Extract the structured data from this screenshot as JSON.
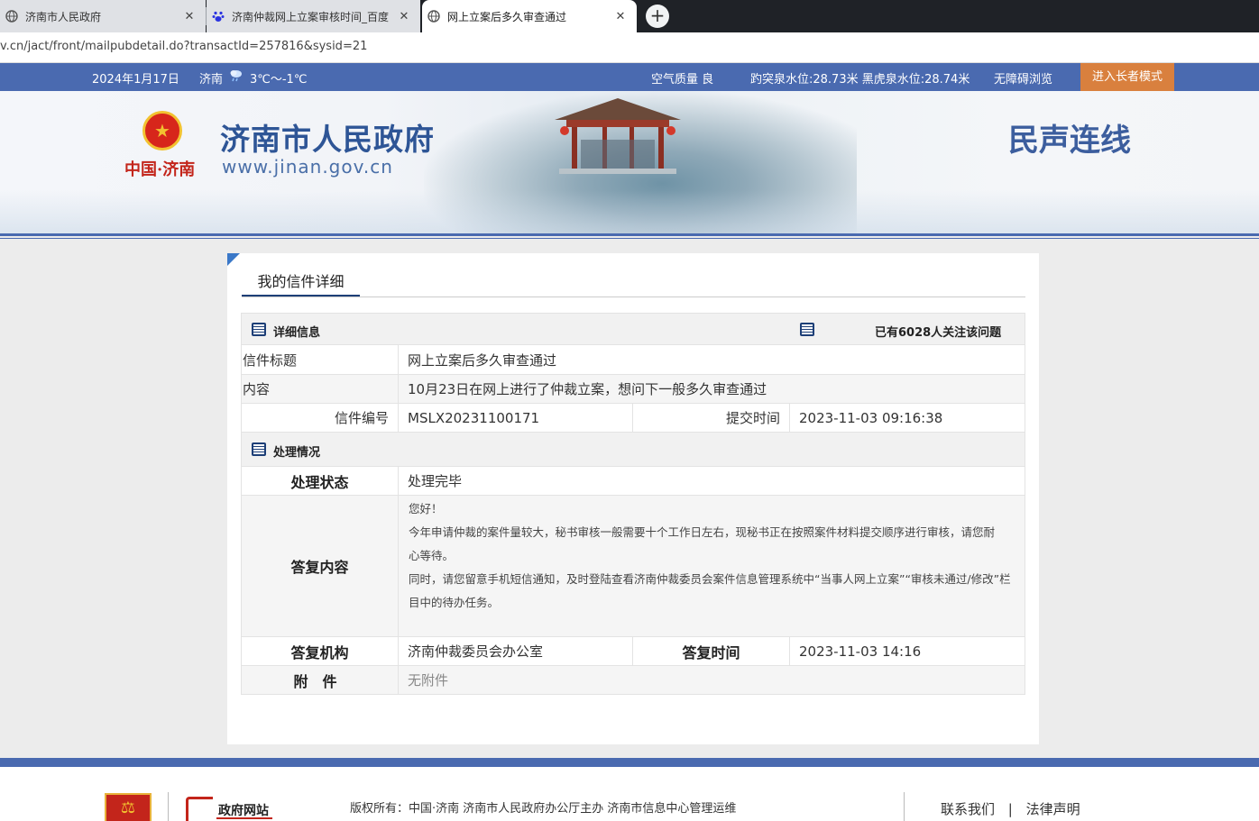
{
  "browser": {
    "tabs": [
      {
        "title": "济南市人民政府",
        "state": "inactive",
        "icon": "globe-icon"
      },
      {
        "title": "济南仲裁网上立案审核时间_百度",
        "state": "inactive",
        "icon": "baidu-paw-icon"
      },
      {
        "title": "网上立案后多久审查通过",
        "state": "active",
        "icon": "globe-icon"
      }
    ],
    "close_glyph": "✕",
    "new_tab_glyph": "+",
    "url": "v.cn/jact/front/mailpubdetail.do?transactId=257816&sysid=21"
  },
  "infobar": {
    "date": "2024年1月17日",
    "city": "济南",
    "weather_icon": "rain-cloud-icon",
    "temperature": "3℃～-1℃",
    "air_quality": "空气质量 良",
    "water_level": "趵突泉水位:28.73米 黑虎泉水位:28.74米",
    "accessibility": "无障碍浏览",
    "elder_mode": "进入长者模式"
  },
  "banner": {
    "emblem_glyph": "★",
    "logo_text": "中国·济南",
    "site_name": "济南市人民政府",
    "site_url": "www.jinan.gov.cn",
    "section": "民声连线"
  },
  "panel": {
    "tab_label": "我的信件详细",
    "detail": {
      "heading": "详细信息",
      "followers": "已有6028人关注该问题",
      "title_label": "信件标题",
      "title_value": "网上立案后多久审查通过",
      "content_label": "内容",
      "content_value": "10月23日在网上进行了仲裁立案，想问下一般多久审查通过",
      "number_label": "信件编号",
      "number_value": "MSLX20231100171",
      "submit_label": "提交时间",
      "submit_value": "2023-11-03 09:16:38"
    },
    "handling": {
      "heading": "处理情况",
      "status_label": "处理状态",
      "status_value": "处理完毕",
      "reply_label": "答复内容",
      "reply_lines": [
        "您好！",
        "今年申请仲裁的案件量较大，秘书审核一般需要十个工作日左右，现秘书正在按照案件材料提交顺序进行审核，请您耐",
        "心等待。",
        "同时，请您留意手机短信通知，及时登陆查看济南仲裁委员会案件信息管理系统中“当事人网上立案”“审核未通过/修改”栏",
        "目中的待办任务。"
      ],
      "org_label": "答复机构",
      "org_value": "济南仲裁委员会办公室",
      "time_label": "答复时间",
      "time_value": "2023-11-03 14:16",
      "attach_label": "附　件",
      "attach_value": "无附件"
    }
  },
  "footer": {
    "logo1_glyph": "⚖",
    "logo2_text": "政府网站",
    "copyright": "版权所有：中国·济南 济南市人民政府办公厅主办 济南市信息中心管理运维",
    "contact": "联系我们",
    "divider": "|",
    "legal": "法律声明"
  },
  "colors": {
    "brand_blue": "#4a6ab0",
    "elder_orange": "#d9803e",
    "title_blue": "#2e5596"
  }
}
